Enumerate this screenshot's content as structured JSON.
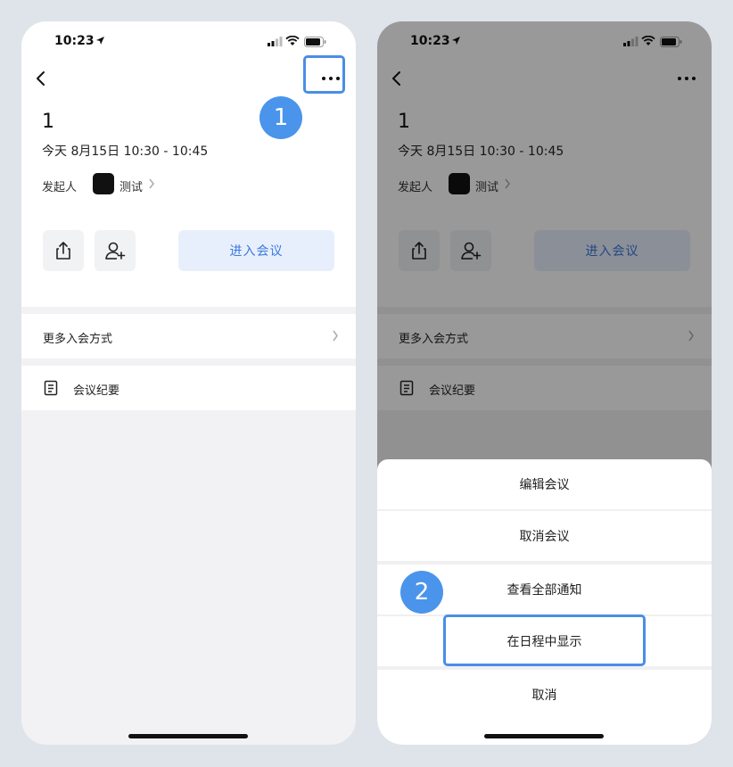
{
  "status_bar": {
    "time": "10:23"
  },
  "meeting": {
    "title": "1",
    "datetime": "今天 8月15日 10:30 - 10:45",
    "host_label": "发起人",
    "host_name": "测试",
    "join_label": "进入会议"
  },
  "rows": {
    "more_join": "更多入会方式",
    "minutes": "会议纪要"
  },
  "action_sheet": {
    "items": [
      "编辑会议",
      "取消会议",
      "查看全部通知",
      "在日程中显示"
    ],
    "cancel": "取消"
  },
  "annotations": {
    "step1": "1",
    "step2": "2"
  },
  "colors": {
    "accent": "#4a8ee6",
    "join_bg": "#e8effc",
    "join_text": "#3a79dc"
  }
}
